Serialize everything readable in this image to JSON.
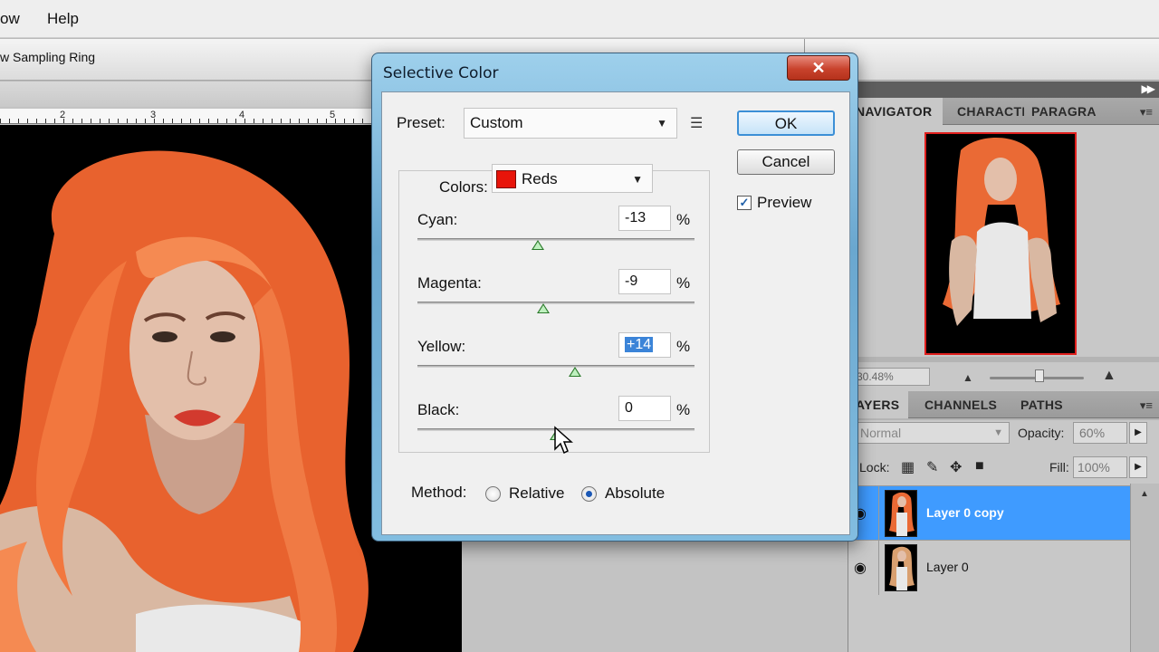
{
  "menubar": {
    "items": [
      "ow",
      "Help"
    ]
  },
  "options_bar": {
    "label": "w Sampling Ring"
  },
  "ruler": {
    "numbers": [
      "2",
      "3",
      "4",
      "5"
    ]
  },
  "navigator_panel": {
    "tabs": [
      "NAVIGATOR",
      "CHARACTI",
      "PARAGRA"
    ],
    "zoom": "30.48%"
  },
  "layers_panel": {
    "tabs": [
      "AYERS",
      "CHANNELS",
      "PATHS"
    ],
    "blend_mode": "Normal",
    "opacity_label": "Opacity:",
    "opacity_value": "60%",
    "lock_label": "Lock:",
    "fill_label": "Fill:",
    "fill_value": "100%",
    "layers": [
      {
        "name": "Layer 0 copy",
        "selected": true
      },
      {
        "name": "Layer 0",
        "selected": false
      }
    ]
  },
  "dialog": {
    "title": "Selective Color",
    "close_glyph": "✕",
    "preset_label": "Preset:",
    "preset_value": "Custom",
    "ok_label": "OK",
    "cancel_label": "Cancel",
    "preview_label": "Preview",
    "preview_checked": true,
    "colors_label": "Colors:",
    "colors_value": "Reds",
    "colors_swatch": "#e8140a",
    "sliders": [
      {
        "label": "Cyan:",
        "value": "-13",
        "percent": -13
      },
      {
        "label": "Magenta:",
        "value": "-9",
        "percent": -9
      },
      {
        "label": "Yellow:",
        "value": "+14",
        "percent": 14
      },
      {
        "label": "Black:",
        "value": "0",
        "percent": 0
      }
    ],
    "pct_sign": "%",
    "method_label": "Method:",
    "method_options": [
      "Relative",
      "Absolute"
    ],
    "method_selected": "Absolute"
  },
  "colors": {
    "selection_blue": "#3f9bff",
    "hair": "#f0703c"
  }
}
